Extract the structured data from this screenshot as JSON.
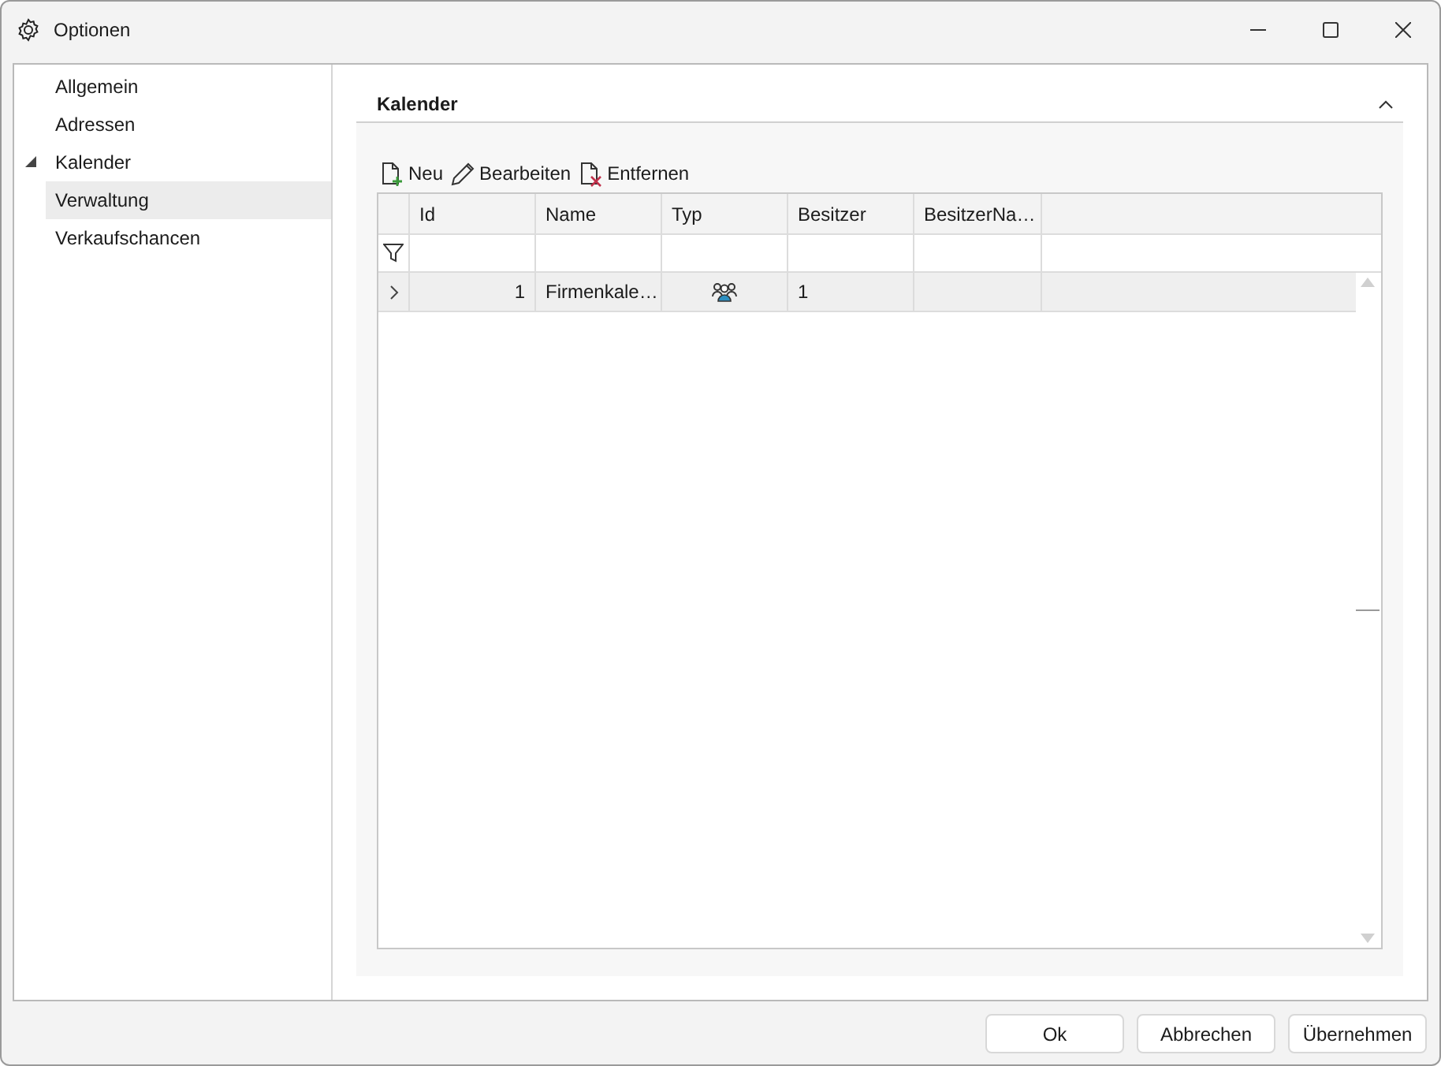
{
  "window": {
    "title": "Optionen"
  },
  "sidebar": {
    "items": [
      {
        "label": "Allgemein",
        "selected": false
      },
      {
        "label": "Adressen",
        "selected": false
      },
      {
        "label": "Kalender",
        "selected": false,
        "expanded": true,
        "children": [
          {
            "label": "Verwaltung",
            "selected": true
          }
        ]
      },
      {
        "label": "Verkaufschancen",
        "selected": false
      }
    ]
  },
  "section": {
    "title": "Kalender",
    "expanded": true,
    "toolbar": [
      {
        "label": "Neu",
        "kind": "new"
      },
      {
        "label": "Bearbeiten",
        "kind": "edit"
      },
      {
        "label": "Entfernen",
        "kind": "remove"
      }
    ],
    "table": {
      "columns": [
        "Id",
        "Name",
        "Typ",
        "Besitzer",
        "BesitzerNa…"
      ],
      "rows": [
        {
          "selected": true,
          "expanded": false,
          "id": "1",
          "name": "Firmenkale…",
          "kind": "group",
          "owner": "1"
        }
      ]
    }
  },
  "buttons": [
    "Ok",
    "Abbrechen",
    "Übernehmen"
  ]
}
